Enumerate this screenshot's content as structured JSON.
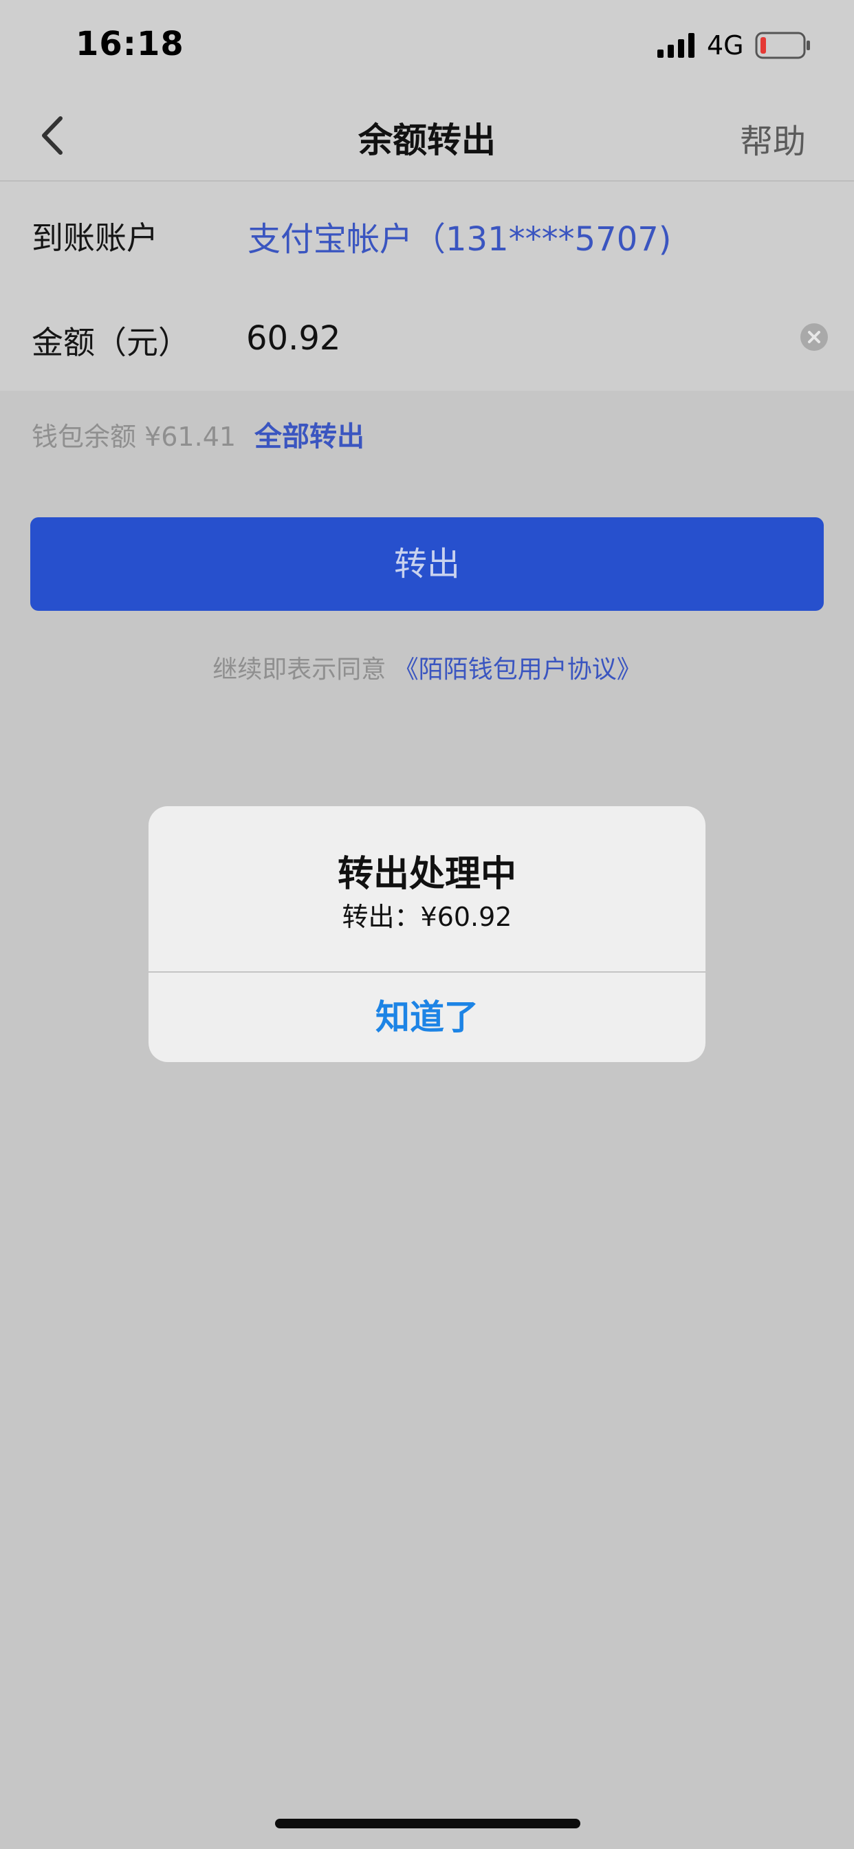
{
  "status_bar": {
    "time": "16:18",
    "network": "4G",
    "signal_icon": "cellular-signal-icon",
    "battery_icon": "battery-low-icon",
    "battery_color": "#e53935"
  },
  "nav": {
    "back_icon": "chevron-left-icon",
    "title": "余额转出",
    "help": "帮助"
  },
  "form": {
    "account_label": "到账账户",
    "account_value": "支付宝帐户（131****5707)",
    "amount_label": "金额（元）",
    "amount_value": "60.92",
    "clear_icon": "clear-x-icon"
  },
  "balance": {
    "text": "钱包余额 ¥61.41",
    "transfer_all": "全部转出"
  },
  "submit_label": "转出",
  "agreement": {
    "prefix": "继续即表示同意 ",
    "link": "《陌陌钱包用户协议》"
  },
  "dialog": {
    "title": "转出处理中",
    "message": "转出：¥60.92",
    "ok_label": "知道了"
  },
  "colors": {
    "accent": "#2750cd",
    "link": "#3a55c0",
    "dialog_button": "#1d84e5",
    "overlay_background": "#c6c6c6"
  }
}
